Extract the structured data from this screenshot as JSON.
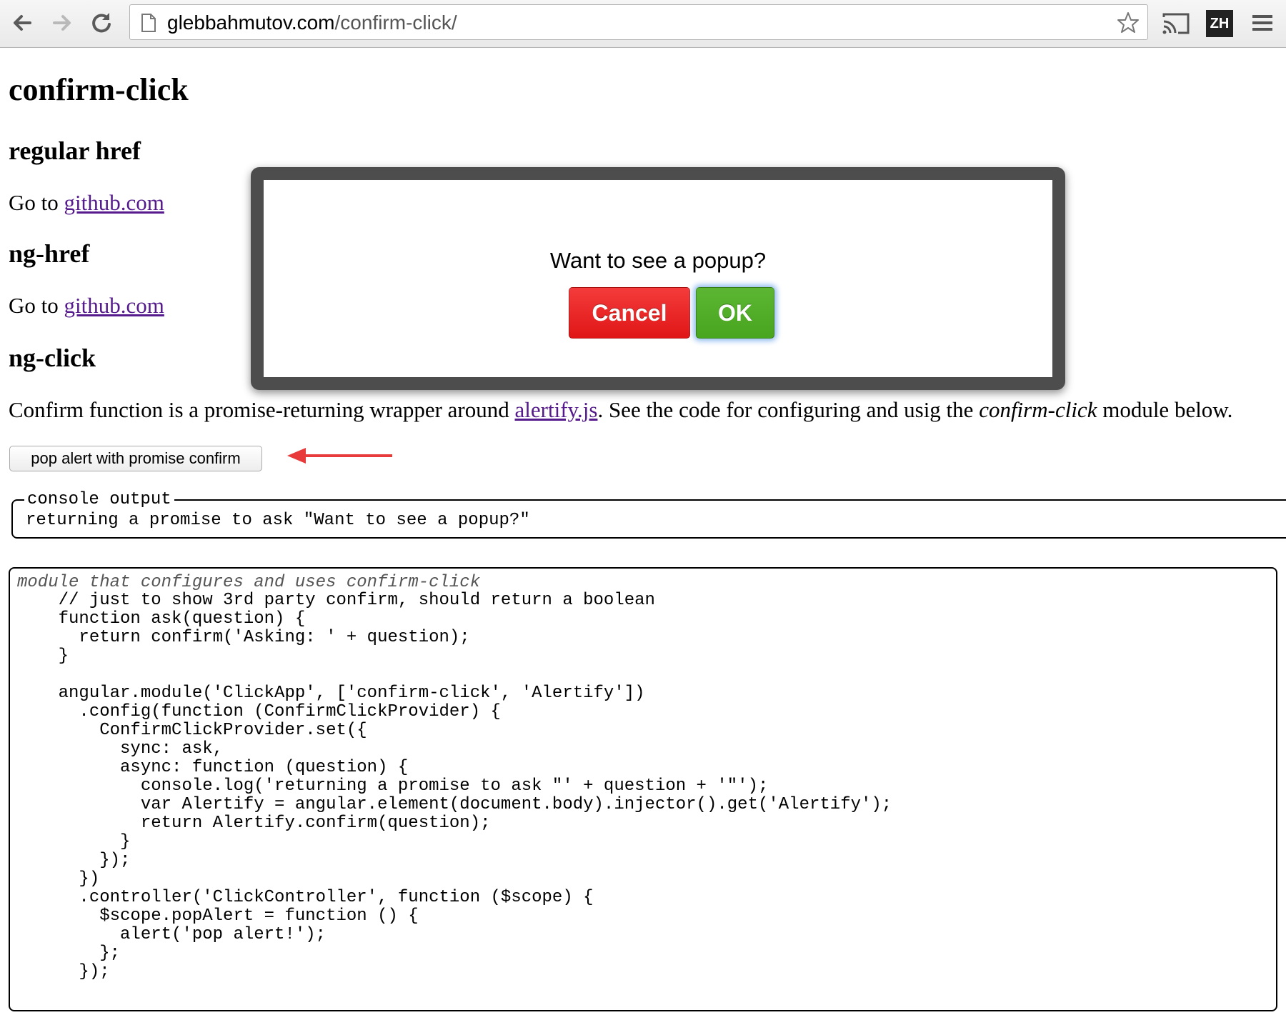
{
  "browser": {
    "url_host": "glebbahmutov.com",
    "url_path": "/confirm-click/",
    "extension_label": "ZH",
    "icons": [
      "back-arrow-icon",
      "forward-arrow-icon",
      "reload-icon",
      "page-icon",
      "bookmark-star-icon",
      "cast-icon",
      "menu-icon"
    ]
  },
  "page": {
    "title": "confirm-click",
    "sections": {
      "regular_href": {
        "heading": "regular href",
        "text": "Go to ",
        "link": "github.com"
      },
      "ng_href": {
        "heading": "ng-href",
        "text": "Go to ",
        "link": "github.com"
      },
      "ng_click": {
        "heading": "ng-click",
        "desc_before": "Confirm function is a promise-returning wrapper around ",
        "desc_link": "alertify.js",
        "desc_middle": ". See the code for configuring and usig the ",
        "desc_em": "confirm-click",
        "desc_after": " module below."
      }
    },
    "pop_button_label": "pop alert with promise confirm",
    "console": {
      "legend": "console output",
      "text": "returning a promise to ask \"Want to see a popup?\""
    },
    "code_block": {
      "caption": "module that configures and uses confirm-click",
      "code": "    // just to show 3rd party confirm, should return a boolean\n    function ask(question) {\n      return confirm('Asking: ' + question);\n    }\n\n    angular.module('ClickApp', ['confirm-click', 'Alertify'])\n      .config(function (ConfirmClickProvider) {\n        ConfirmClickProvider.set({\n          sync: ask,\n          async: function (question) {\n            console.log('returning a promise to ask \"' + question + '\"');\n            var Alertify = angular.element(document.body).injector().get('Alertify');\n            return Alertify.confirm(question);\n          }\n        });\n      })\n      .controller('ClickController', function ($scope) {\n        $scope.popAlert = function () {\n          alert('pop alert!');\n        };\n      });"
    }
  },
  "modal": {
    "message": "Want to see a popup?",
    "cancel_label": "Cancel",
    "ok_label": "OK"
  },
  "colors": {
    "link": "#551a8b",
    "cancel": "#e82626",
    "ok": "#52ad27",
    "modal_border": "#4d4d4d",
    "arrow": "#e83a3a"
  }
}
